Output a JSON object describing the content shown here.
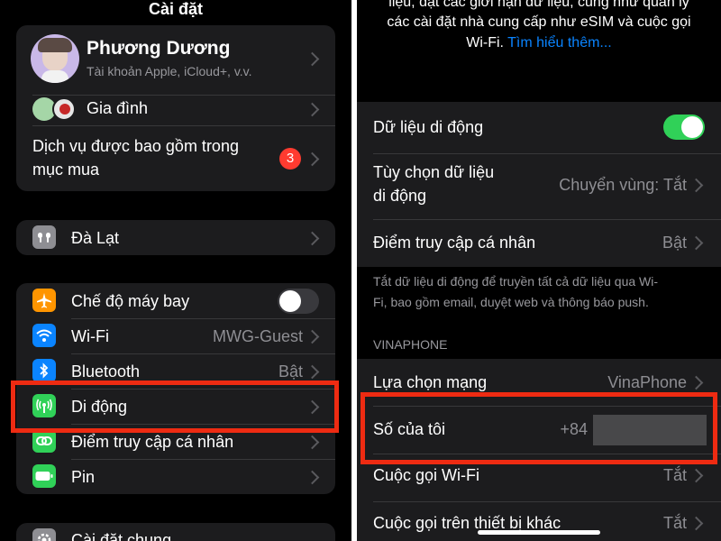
{
  "left": {
    "nav_title": "Cài đặt",
    "profile": {
      "name": "Phương Dương",
      "subtitle": "Tài khoản Apple, iCloud+, v.v."
    },
    "family": {
      "label": "Gia đình"
    },
    "services": {
      "label_line1": "Dịch vụ được bao gồm trong",
      "label_line2": "mục mua",
      "badge": "3"
    },
    "device": {
      "label": "Đà Lạt"
    },
    "settings": [
      {
        "label": "Chế độ máy bay",
        "value": "",
        "icon": "airplane-icon",
        "color": "#ff9500",
        "toggle": "off"
      },
      {
        "label": "Wi-Fi",
        "value": "MWG-Guest",
        "icon": "wifi-icon",
        "color": "#0a84ff"
      },
      {
        "label": "Bluetooth",
        "value": "Bật",
        "icon": "bluetooth-icon",
        "color": "#0a84ff"
      },
      {
        "label": "Di động",
        "value": "",
        "icon": "antenna-icon",
        "color": "#30d158"
      },
      {
        "label": "Điểm truy cập cá nhân",
        "value": "",
        "icon": "link-icon",
        "color": "#30d158"
      },
      {
        "label": "Pin",
        "value": "",
        "icon": "battery-icon",
        "color": "#30d158"
      }
    ],
    "general": {
      "label": "Cài đặt chung"
    }
  },
  "right": {
    "top_text_line1": "liệu, đặt các giới hạn dữ liệu, cũng như quản lý",
    "top_text_line2": "các cài đặt nhà cung cấp như eSIM và cuộc gọi",
    "top_text_line3": "Wi-Fi.",
    "learn_more": "Tìm hiểu thêm...",
    "mobile_data": {
      "label": "Dữ liệu di động",
      "toggle": "on"
    },
    "data_options": {
      "label_line1": "Tùy chọn dữ liệu",
      "label_line2": "di động",
      "value": "Chuyển vùng: Tắt"
    },
    "hotspot": {
      "label": "Điểm truy cập cá nhân",
      "value": "Bật"
    },
    "footer_line1": "Tắt dữ liệu di động để truyền tất cả dữ liệu qua Wi-",
    "footer_line2": "Fi, bao gồm email, duyệt web và thông báo push.",
    "section_header": "VINAPHONE",
    "network": {
      "label": "Lựa chọn mạng",
      "value": "VinaPhone"
    },
    "my_number": {
      "label": "Số của tôi",
      "value": "+84"
    },
    "wifi_calling": {
      "label": "Cuộc gọi Wi-Fi",
      "value": "Tắt"
    },
    "other_devices": {
      "label": "Cuộc gọi trên thiết bị khác",
      "value": "Tắt"
    }
  },
  "colors": {
    "highlight": "#ee2b12",
    "toggle_on": "#30d158",
    "badge": "#ff3b30",
    "link": "#0a84ff"
  }
}
